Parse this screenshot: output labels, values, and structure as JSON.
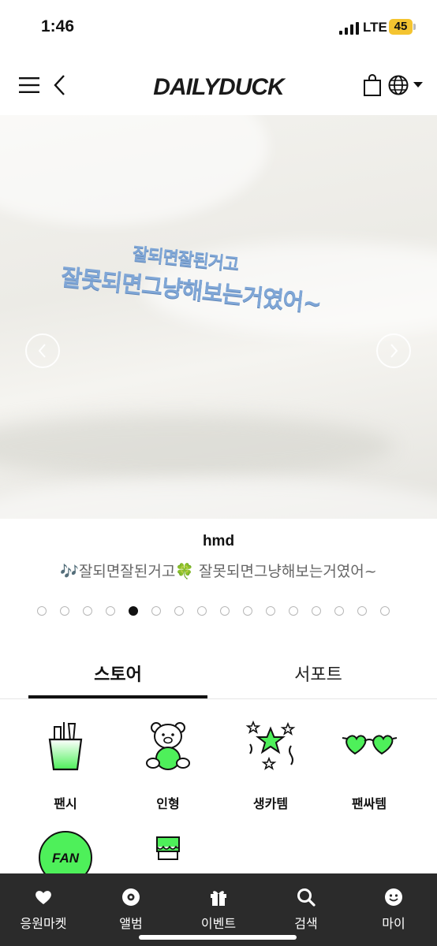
{
  "status": {
    "time": "1:46",
    "network": "LTE",
    "battery": "45"
  },
  "header": {
    "logo": "DAILYDUCK"
  },
  "banner": {
    "embroidery_line1": "잘되면잘된거고",
    "embroidery_line2": "잘못되면그냥해보는거였어~",
    "title": "hmd",
    "subtitle": "🎶잘되면잘된거고🍀 잘못되면그냥해보는거였어~",
    "total_slides": 16,
    "active_slide": 5
  },
  "tabs": [
    {
      "label": "스토어",
      "active": true
    },
    {
      "label": "서포트",
      "active": false
    }
  ],
  "categories": [
    {
      "label": "팬시",
      "icon": "pencil-cup-icon"
    },
    {
      "label": "인형",
      "icon": "teddy-bear-icon"
    },
    {
      "label": "생카템",
      "icon": "stars-icon"
    },
    {
      "label": "팬싸템",
      "icon": "heart-glasses-icon"
    },
    {
      "label": "FAN",
      "icon": "fan-badge-icon"
    },
    {
      "label": "",
      "icon": "paint-brush-icon"
    }
  ],
  "bottom_nav": [
    {
      "label": "응원마켓",
      "icon": "heart-icon"
    },
    {
      "label": "앨범",
      "icon": "disc-icon"
    },
    {
      "label": "이벤트",
      "icon": "gift-icon"
    },
    {
      "label": "검색",
      "icon": "search-icon"
    },
    {
      "label": "마이",
      "icon": "smile-icon"
    }
  ],
  "colors": {
    "accent_green": "#4ef05a",
    "nav_bg": "#2b2b2b",
    "embroidery_blue": "#7fa6d6"
  }
}
